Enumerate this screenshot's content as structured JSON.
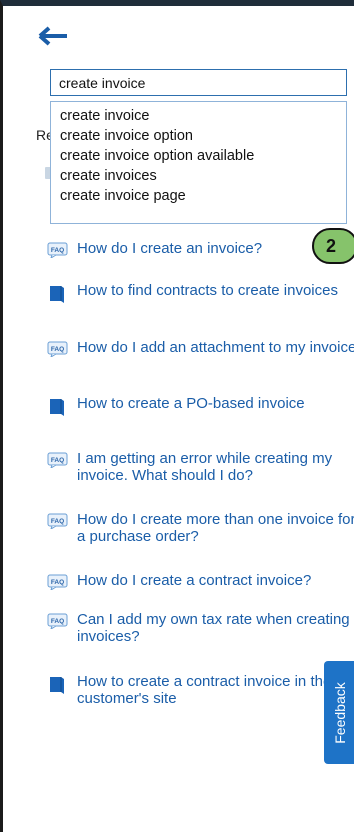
{
  "search": {
    "value": "create invoice",
    "suggestions": [
      "create invoice",
      "create invoice option",
      "create invoice option available",
      "create invoices",
      "create invoice page"
    ]
  },
  "results": {
    "label_partial": "Re",
    "items": [
      {
        "type": "faq",
        "title": "How do I create an invoice?"
      },
      {
        "type": "doc",
        "title": "How to find contracts to create invoices"
      },
      {
        "type": "faq",
        "title": "How do I add an attachment to my invoice?"
      },
      {
        "type": "doc",
        "title": "How to create a PO-based invoice"
      },
      {
        "type": "faq",
        "title": "I am getting an error while creating my invoice. What should I do?"
      },
      {
        "type": "faq",
        "title": "How do I create more than one invoice for a purchase order?"
      },
      {
        "type": "faq",
        "title": "How do I create a contract invoice?"
      },
      {
        "type": "faq",
        "title": "Can I add my own tax rate when creating invoices?"
      },
      {
        "type": "doc",
        "title": "How to create a contract invoice in the customer's site"
      }
    ]
  },
  "faq_icon_text": "FAQ",
  "badge": {
    "number": "2",
    "color": "#86c36b"
  },
  "feedback": {
    "label": "Feedback",
    "color": "#1e73c7"
  },
  "colors": {
    "link": "#1a5da8",
    "accent": "#1e73c7"
  },
  "icons": {
    "back": "arrow-left-icon",
    "faq": "faq-chat-icon",
    "doc": "book-icon"
  }
}
